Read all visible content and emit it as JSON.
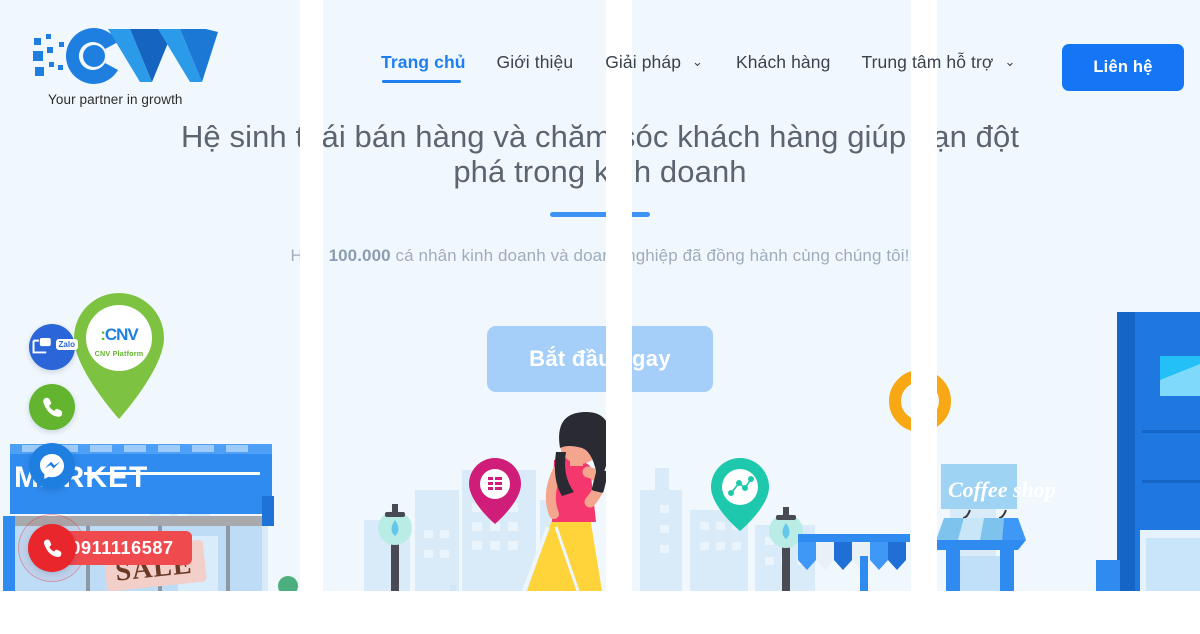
{
  "site": {
    "background_color": "#f1f8fd",
    "accent_color": "#1476f5"
  },
  "logo": {
    "name": "CNV",
    "tagline": "Your partner in growth",
    "mark_colors": [
      "#1e7fe0",
      "#1464c0",
      "#2b9ae8"
    ]
  },
  "nav": {
    "items": [
      {
        "label": "Trang chủ",
        "active": true,
        "has_dropdown": false
      },
      {
        "label": "Giới thiệu",
        "active": false,
        "has_dropdown": false
      },
      {
        "label": "Giải pháp",
        "active": false,
        "has_dropdown": true
      },
      {
        "label": "Khách hàng",
        "active": false,
        "has_dropdown": false
      },
      {
        "label": "Trung tâm hỗ trợ",
        "active": false,
        "has_dropdown": true
      }
    ],
    "caret_glyph": "⌄",
    "contact_button": "Liên hệ"
  },
  "hero": {
    "headline": "Hệ sinh thái bán hàng và chăm sóc khách hàng giúp bạn đột phá trong kinh doanh",
    "subtitle_prefix": "Hơn ",
    "subtitle_bold": "100.000",
    "subtitle_suffix": " cá nhân kinh doanh và doanh nghiệp đã đồng hành cùng chúng tôi!",
    "cta_label": "Bắt đầu ngay",
    "divider_color": "#3d93f5",
    "headline_color": "#5b6470",
    "subtitle_color": "#9eadbd",
    "cta_color": "#a5cef8"
  },
  "floating_contacts": {
    "zalo_label": "Zalo",
    "phone_number": "0911116587",
    "pin_logo_text": "CNV",
    "pin_label": "CNV Platform",
    "zalo_color": "#2b66d8",
    "phone_color": "#63b42e",
    "messenger_color": "#1e7fe0",
    "call_color": "#e8262b",
    "pill_color": "#ef4b4f",
    "pin_color": "#7ec242"
  },
  "illustration": {
    "market_sign_text": "MARKET",
    "sale_banner_text": "SALE",
    "coffee_sign_text": "Coffee shop",
    "pin_pink_color": "#cf1d79",
    "pin_teal_color": "#1ec8ac",
    "orange_ring_color": "#f7a814",
    "building_blue": "#1476f5",
    "city_blue": "#cfe5f8",
    "woman_top_color": "#f4376d",
    "woman_skirt_color": "#ffd33a"
  }
}
